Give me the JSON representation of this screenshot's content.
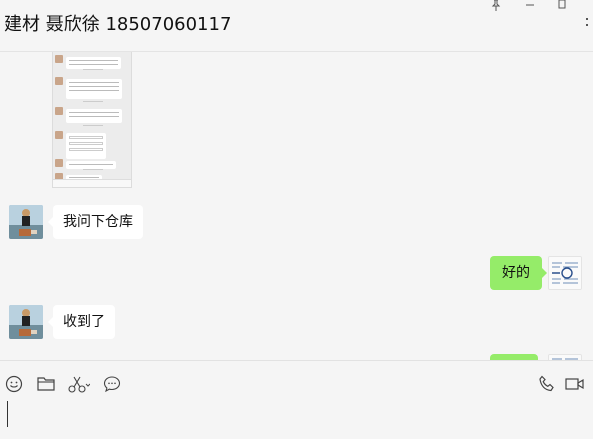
{
  "header": {
    "chat_title": "建材 聂欣徐 18507060117"
  },
  "messages": [
    {
      "type": "image",
      "from": "contact"
    },
    {
      "type": "text",
      "from": "contact",
      "text": "我问下仓库"
    },
    {
      "type": "text",
      "from": "self",
      "text": "好的"
    },
    {
      "type": "text",
      "from": "contact",
      "text": "收到了"
    },
    {
      "type": "text",
      "from": "self",
      "text": ""
    }
  ],
  "toolbar": {
    "icons": [
      "emoji-icon",
      "folder-icon",
      "scissors-icon",
      "chat-bubble-icon",
      "phone-icon",
      "video-icon"
    ]
  },
  "colors": {
    "outgoing_bubble": "#95ec69",
    "incoming_bubble": "#ffffff",
    "background": "#f5f5f5"
  }
}
